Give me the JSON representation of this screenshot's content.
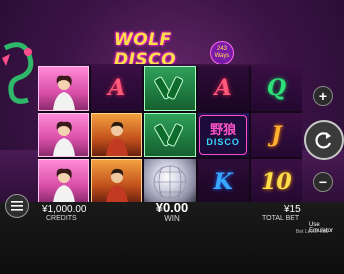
{
  "game": {
    "logo_main": "WOLF DISCO",
    "logo_badge_line1": "243",
    "logo_badge_line2": "Ways"
  },
  "reels": [
    [
      "lady",
      "lady",
      "lady"
    ],
    [
      "A",
      "man",
      "man"
    ],
    [
      "bottle",
      "bottle",
      "disco-ball"
    ],
    [
      "A",
      "wild",
      "K"
    ],
    [
      "Q",
      "J",
      "10"
    ]
  ],
  "wild_symbol": {
    "top": "野狼",
    "bottom": "DISCO"
  },
  "symbols_text": {
    "r1_top": "A",
    "r3_top": "A",
    "r3_bottom": "K",
    "r4_top": "Q",
    "r4_mid": "J",
    "r4_bottom": "10"
  },
  "bottom_bar": {
    "credits_value": "¥1,000.00",
    "credits_label": "CREDITS",
    "win_value": "¥0.00",
    "win_label": "WIN",
    "bet_value": "¥15",
    "bet_label": "TOTAL BET",
    "emulator_label": "Use Emulator",
    "bet_level": "Bet Level:  X50"
  },
  "buttons": {
    "plus": "+",
    "minus": "−"
  },
  "colors": {
    "letter_a": "#ff5a7a",
    "letter_q": "#2fe07a",
    "letter_j": "#ffb030",
    "letter_k": "#3aa8ff",
    "letter_10": "#ffe04a",
    "bar": "#111111"
  }
}
